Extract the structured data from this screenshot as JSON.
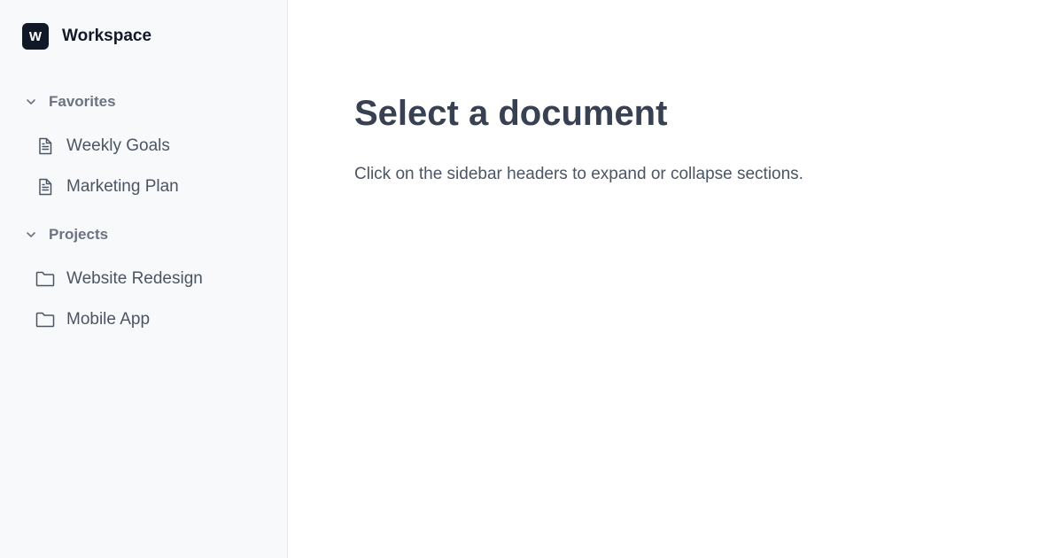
{
  "brand": {
    "logo_letter": "W",
    "name": "Workspace"
  },
  "sidebar": {
    "sections": [
      {
        "label": "Favorites",
        "chevron_icon": "chevron-down-icon",
        "items": [
          {
            "label": "Weekly Goals",
            "icon": "document-icon"
          },
          {
            "label": "Marketing Plan",
            "icon": "document-icon"
          }
        ]
      },
      {
        "label": "Projects",
        "chevron_icon": "chevron-down-icon",
        "items": [
          {
            "label": "Website Redesign",
            "icon": "folder-icon"
          },
          {
            "label": "Mobile App",
            "icon": "folder-icon"
          }
        ]
      }
    ]
  },
  "main": {
    "title": "Select a document",
    "description": "Click on the sidebar headers to expand or collapse sections."
  },
  "colors": {
    "sidebar_bg": "#f8f9fb",
    "logo_bg": "#111827",
    "text_primary": "#374151",
    "text_muted": "#6b7280"
  }
}
